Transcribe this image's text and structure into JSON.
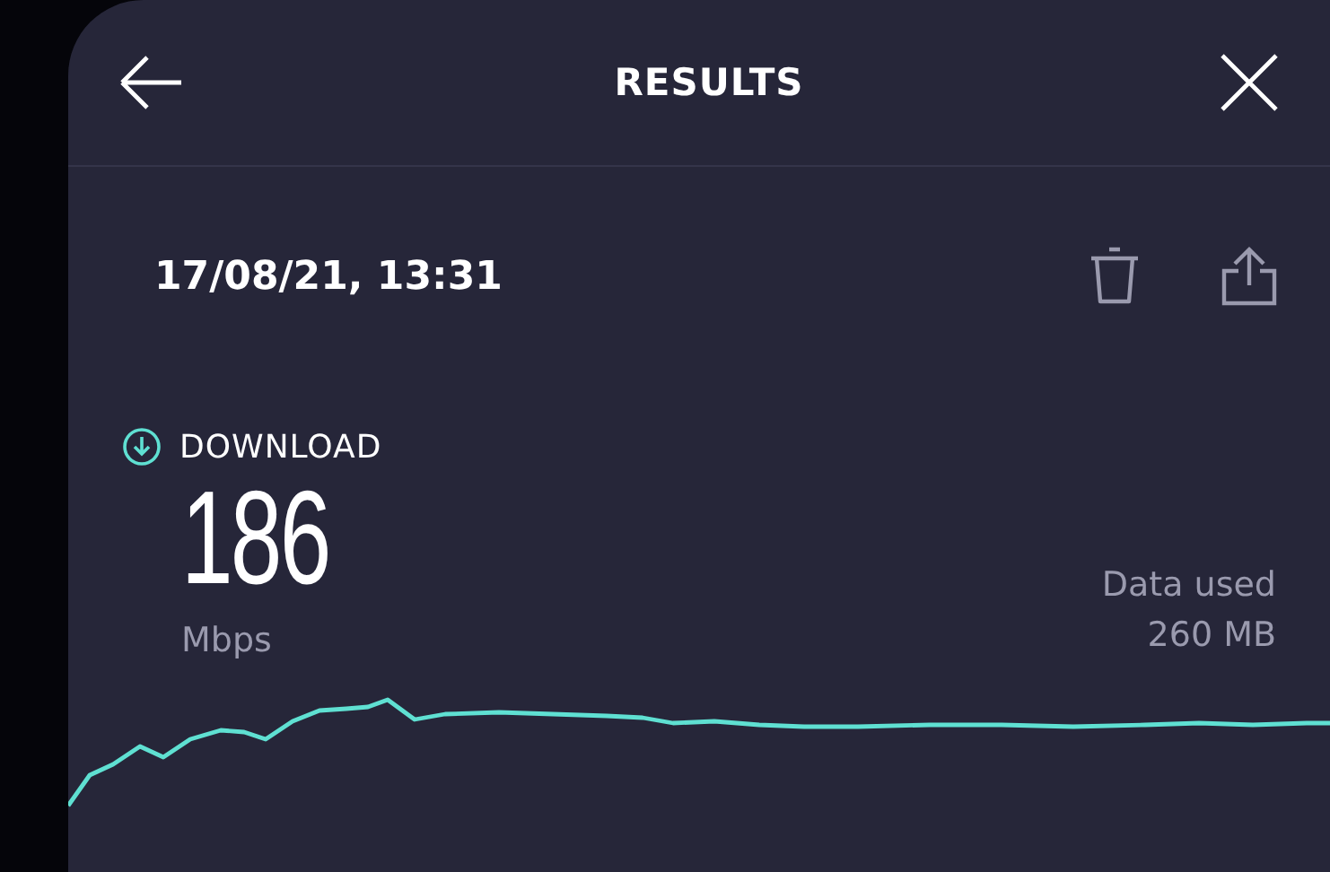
{
  "header": {
    "title": "RESULTS"
  },
  "result": {
    "timestamp": "17/08/21, 13:31"
  },
  "download": {
    "label": "DOWNLOAD",
    "value": "186",
    "unit": "Mbps"
  },
  "data_used": {
    "label": "Data used",
    "value": "260 MB"
  }
}
